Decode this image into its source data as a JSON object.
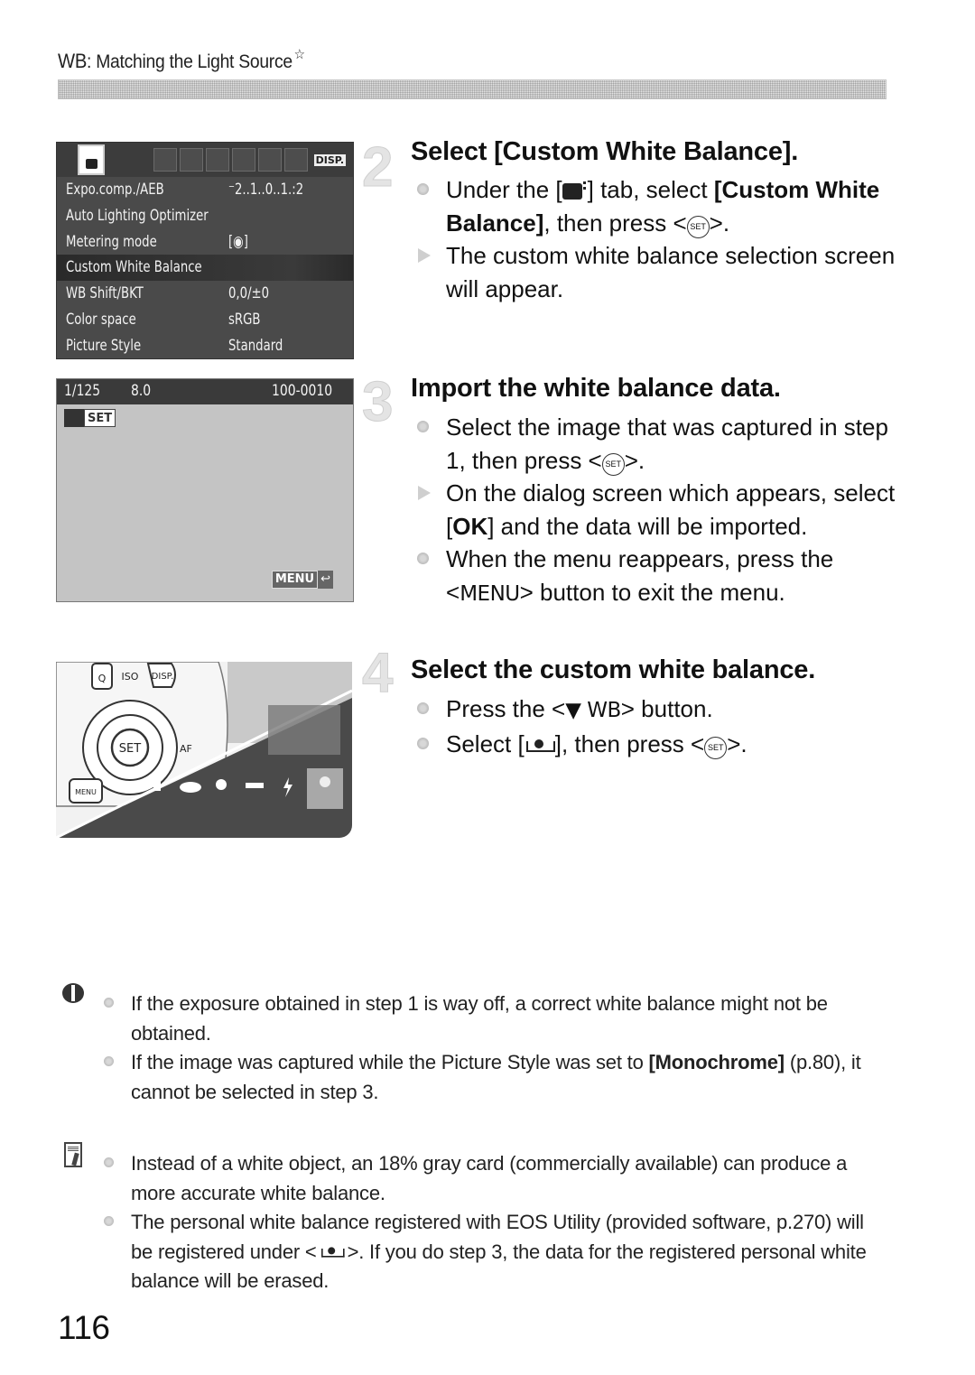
{
  "header": {
    "prefix": "WB",
    "title": ": Matching the Light Source",
    "star": "☆"
  },
  "camera_menu": {
    "rows": [
      {
        "label": "Expo.comp./AEB",
        "value": "⁻2..1..0..1.:2"
      },
      {
        "label": "Auto Lighting Optimizer",
        "value": ""
      },
      {
        "label": "Metering mode",
        "value": "[◉]"
      },
      {
        "label": "Custom White Balance",
        "value": "",
        "selected": true
      },
      {
        "label": "WB Shift/BKT",
        "value": "0,0/±0"
      },
      {
        "label": "Color space",
        "value": "sRGB"
      },
      {
        "label": "Picture Style",
        "value": "Standard"
      }
    ],
    "disp_label": "DISP."
  },
  "camera_playback": {
    "shutter": "1/125",
    "aperture": "8.0",
    "file_number": "100-0010",
    "set_label": "SET",
    "menu_label": "MENU",
    "return_glyph": "↩"
  },
  "camera_photo": {
    "labels": {
      "q": "Q",
      "iso": "ISO",
      "disp": "DISP.",
      "set": "SET",
      "af": "AF",
      "menu": "MENU"
    }
  },
  "steps": [
    {
      "number": "2",
      "title": "Select [Custom White Balance].",
      "items": [
        {
          "marker": "circle",
          "parts": [
            "Under the [",
            "",
            "] tab, select ",
            "[Custom White Balance]",
            ", then press <",
            "SET",
            ">."
          ]
        },
        {
          "marker": "triangle",
          "text": "The custom white balance selection screen will appear."
        }
      ]
    },
    {
      "number": "3",
      "title": "Import the white balance data.",
      "items": [
        {
          "marker": "circle",
          "parts": [
            "Select the image that was captured in step 1, then press <",
            "SET",
            ">."
          ]
        },
        {
          "marker": "triangle",
          "parts": [
            "On the dialog screen which appears, select [",
            "OK",
            "] and the data will be imported."
          ]
        },
        {
          "marker": "circle",
          "parts": [
            "When the menu reappears, press the <",
            "MENU",
            "> button to exit the menu."
          ]
        }
      ]
    },
    {
      "number": "4",
      "title": "Select the custom white balance.",
      "items": [
        {
          "marker": "circle",
          "parts": [
            "Press the <",
            "▼ WB",
            "> button."
          ]
        },
        {
          "marker": "circle",
          "parts": [
            "Select [",
            "",
            "], then press <",
            "SET",
            ">."
          ]
        }
      ]
    }
  ],
  "caution": {
    "items": [
      {
        "text": "If the exposure obtained in step 1 is way off, a correct white balance might not be obtained."
      },
      {
        "parts": [
          "If the image was captured while the Picture Style was set to ",
          "[Monochrome]",
          " (p.80), it cannot be selected in step 3."
        ]
      }
    ]
  },
  "memo": {
    "items": [
      {
        "text": "Instead of a white object, an 18% gray card (commercially available) can produce a more accurate white balance."
      },
      {
        "parts": [
          "The personal white balance registered with EOS Utility (provided software, p.270) will be registered under <",
          "",
          ">. If you do step 3, the data for the registered personal white balance will be erased."
        ]
      }
    ]
  },
  "page_number": "116"
}
